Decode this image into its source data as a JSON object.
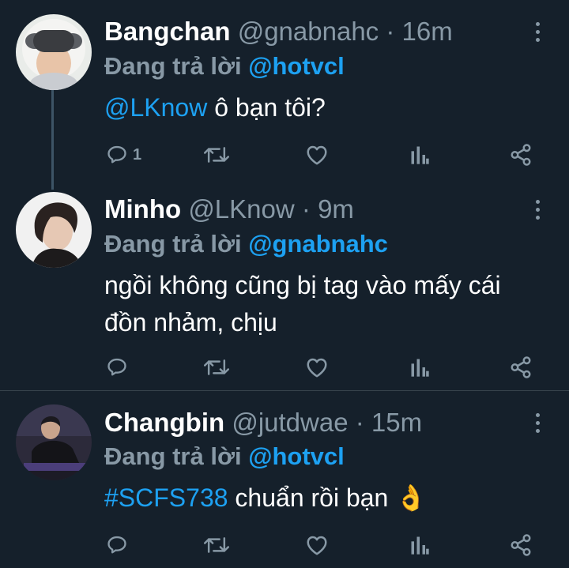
{
  "tweets": [
    {
      "name": "Bangchan",
      "handle": "@gnabnahc",
      "dot": "·",
      "time": "16m",
      "reply_prefix": "Đang trả lời",
      "reply_to": "@hotvcl",
      "body_link": "@LKnow",
      "body_text": " ô bạn tôi?",
      "reply_count": "1"
    },
    {
      "name": "Minho",
      "handle": "@LKnow",
      "dot": "·",
      "time": "9m",
      "reply_prefix": "Đang trả lời",
      "reply_to": "@gnabnahc",
      "body_text": "ngồi không cũng bị tag vào mấy cái đồn nhảm, chịu"
    },
    {
      "name": "Changbin",
      "handle": "@jutdwae",
      "dot": "·",
      "time": "15m",
      "reply_prefix": "Đang trả lời",
      "reply_to": "@hotvcl",
      "body_link": "#SCFS738",
      "body_text": " chuẩn rồi bạn ",
      "emoji": "👌"
    }
  ],
  "icons": {
    "reply": "reply-icon",
    "retweet": "retweet-icon",
    "like": "heart-icon",
    "analytics": "analytics-icon",
    "share": "share-icon",
    "more": "more-vertical-icon"
  },
  "colors": {
    "background": "#15202b",
    "link": "#1da1f2",
    "muted": "#8899a6",
    "divider": "#38444d"
  }
}
